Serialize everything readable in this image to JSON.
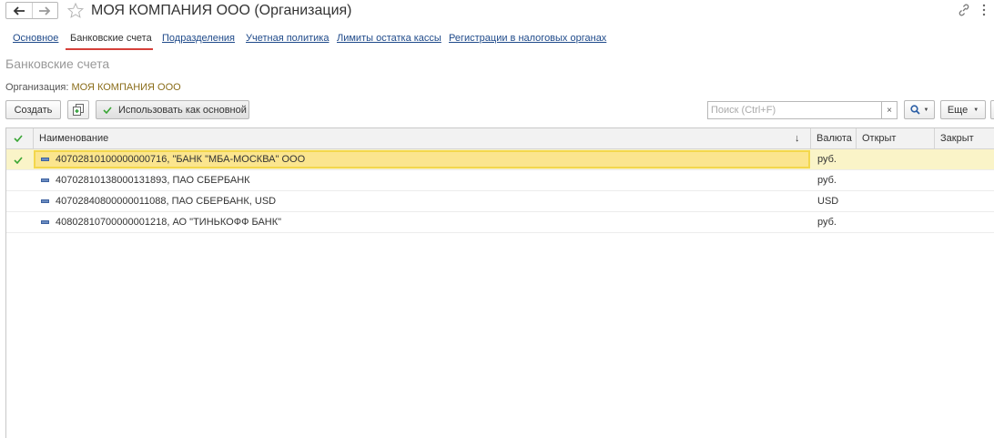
{
  "window": {
    "title": "МОЯ КОМПАНИЯ ООО (Организация)"
  },
  "tabs": [
    {
      "label": "Основное",
      "active": false
    },
    {
      "label": "Банковские счета",
      "active": true
    },
    {
      "label": "Подразделения",
      "active": false
    },
    {
      "label": "Учетная политика",
      "active": false
    },
    {
      "label": "Лимиты остатка кассы",
      "active": false
    },
    {
      "label": "Регистрации в налоговых органах",
      "active": false
    }
  ],
  "section_title": "Банковские счета",
  "organization": {
    "label": "Организация:",
    "value": "МОЯ КОМПАНИЯ ООО"
  },
  "toolbar": {
    "create_label": "Создать",
    "set_default_label": "Использовать как основной",
    "search_placeholder": "Поиск (Ctrl+F)",
    "search_value": "",
    "clear_label": "×",
    "more_label": "Еще"
  },
  "table": {
    "columns": [
      "Наименование",
      "Валюта",
      "Открыт",
      "Закрыт"
    ],
    "rows": [
      {
        "name": "40702810100000000716, \"БАНК \"МБА-МОСКВА\" ООО",
        "currency": "руб.",
        "opened": "",
        "closed": "",
        "is_default": true,
        "selected": true
      },
      {
        "name": "40702810138000131893, ПАО СБЕРБАНК",
        "currency": "руб.",
        "opened": "",
        "closed": "",
        "is_default": false,
        "selected": false
      },
      {
        "name": "40702840800000011088, ПАО СБЕРБАНК, USD",
        "currency": "USD",
        "opened": "",
        "closed": "",
        "is_default": false,
        "selected": false
      },
      {
        "name": "40802810700000001218, АО \"ТИНЬКОФФ БАНК\"",
        "currency": "руб.",
        "opened": "",
        "closed": "",
        "is_default": false,
        "selected": false
      }
    ]
  },
  "colors": {
    "accent_underline": "#d6403a",
    "link": "#1f4a8a",
    "selected_row": "#faf4c8",
    "selected_cell": "#fbe58e",
    "check_green": "#3aa635",
    "org_value": "#8a6d1a"
  },
  "icons": {
    "back": "arrow-left-icon",
    "forward": "arrow-right-icon",
    "favorite": "star-icon",
    "link": "link-icon",
    "more": "vertical-dots-icon",
    "copy": "copy-icon",
    "default_check": "check-icon",
    "search": "search-icon",
    "row_item": "list-item-icon"
  }
}
